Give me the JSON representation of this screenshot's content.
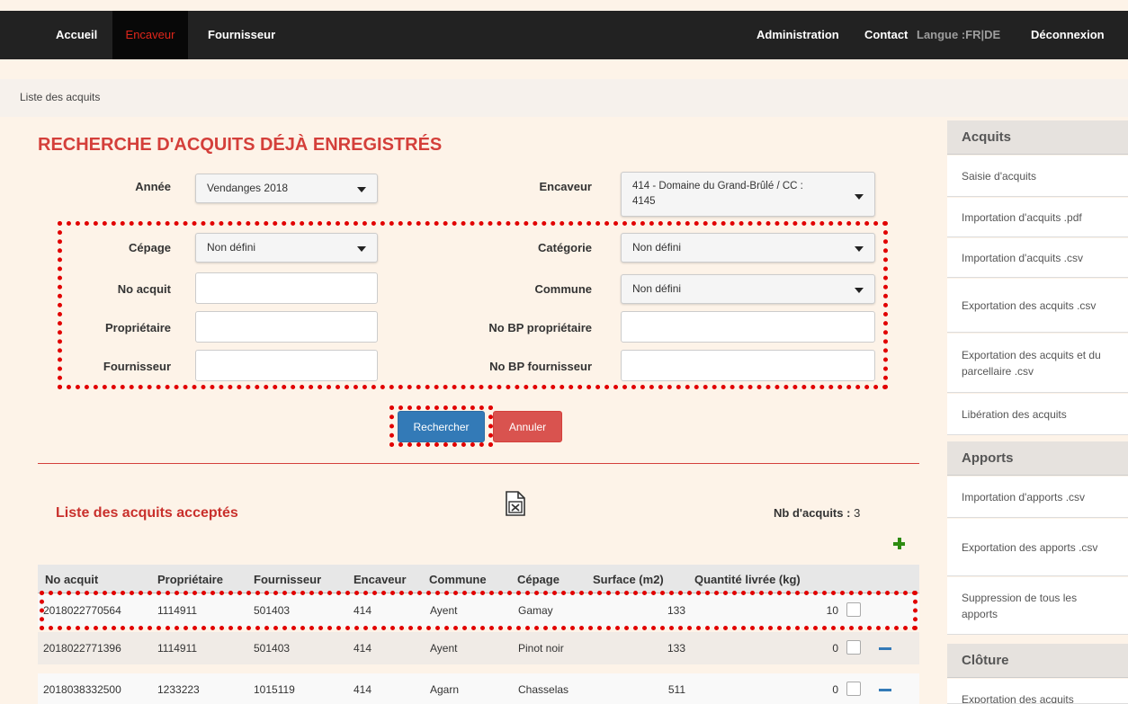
{
  "nav": {
    "accueil": "Accueil",
    "encaveur": "Encaveur",
    "fournisseur": "Fournisseur",
    "administration": "Administration",
    "contact": "Contact",
    "langue": "Langue :FR|DE",
    "deconnexion": "Déconnexion"
  },
  "breadcrumb": "Liste des acquits",
  "page_title": "RECHERCHE D'ACQUITS DÉJÀ ENREGISTRÉS",
  "form": {
    "annee_label": "Année",
    "annee_value": "Vendanges 2018",
    "encaveur_label": "Encaveur",
    "encaveur_value_line1": "414 - Domaine du Grand-Brûlé / CC :",
    "encaveur_value_line2": "4145",
    "cepage_label": "Cépage",
    "cepage_value": "Non défini",
    "categorie_label": "Catégorie",
    "categorie_value": "Non défini",
    "no_acquit_label": "No acquit",
    "commune_label": "Commune",
    "commune_value": "Non défini",
    "proprietaire_label": "Propriétaire",
    "no_bp_proprietaire_label": "No BP propriétaire",
    "fournisseur_label": "Fournisseur",
    "no_bp_fournisseur_label": "No BP fournisseur",
    "search_button": "Rechercher",
    "cancel_button": "Annuler"
  },
  "list": {
    "title": "Liste des acquits acceptés",
    "count_label": "Nb d'acquits :",
    "count_value": "3",
    "columns": [
      "No acquit",
      "Propriétaire",
      "Fournisseur",
      "Encaveur",
      "Commune",
      "Cépage",
      "Surface (m2)",
      "Quantité livrée (kg)"
    ],
    "rows": [
      [
        "2018022770564",
        "1114911",
        "501403",
        "414",
        "Ayent",
        "Gamay",
        "133",
        "10"
      ],
      [
        "2018022771396",
        "1114911",
        "501403",
        "414",
        "Ayent",
        "Pinot noir",
        "133",
        "0"
      ],
      [
        "2018038332500",
        "1233223",
        "1015119",
        "414",
        "Agarn",
        "Chasselas",
        "511",
        "0"
      ]
    ]
  },
  "sidebar": {
    "acquits_title": "Acquits",
    "acquits_items": [
      "Saisie d'acquits",
      "Importation d'acquits .pdf",
      "Importation d'acquits .csv",
      "Exportation des acquits .csv",
      "Exportation des acquits et du parcellaire .csv",
      "Libération des acquits"
    ],
    "apports_title": "Apports",
    "apports_items": [
      "Importation d'apports .csv",
      "Exportation des apports .csv",
      "Suppression de tous les apports"
    ],
    "cloture_title": "Clôture",
    "cloture_items": [
      "Exportation des acquits"
    ]
  },
  "colors": {
    "accent_red": "#d43f3a",
    "primary_blue": "#337ab7",
    "nav_dark": "#222222",
    "add_green": "#2e8b10"
  },
  "icons": [
    "excel-file-icon",
    "plus-icon",
    "minus-icon",
    "caret-down-icon"
  ]
}
